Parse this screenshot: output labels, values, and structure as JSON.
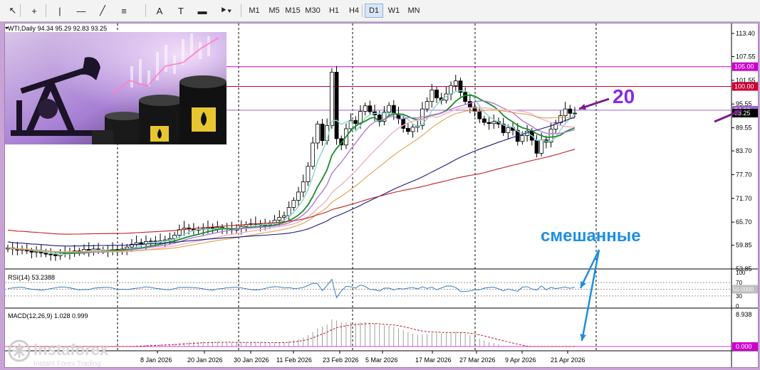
{
  "toolbar": {
    "tools": [
      {
        "name": "cursor",
        "glyph": "↖"
      },
      {
        "name": "crosshair",
        "glyph": "+"
      },
      {
        "name": "vertical-line",
        "glyph": "|"
      },
      {
        "name": "horizontal-line",
        "glyph": "—"
      },
      {
        "name": "trend-line",
        "glyph": "╱"
      },
      {
        "name": "fibonacci",
        "glyph": "≡"
      },
      {
        "name": "text-label",
        "glyph": "A"
      },
      {
        "name": "text-box",
        "glyph": "T"
      },
      {
        "name": "rectangle",
        "glyph": "▬"
      },
      {
        "name": "shapes-dropdown",
        "glyph": "⯈▾"
      }
    ],
    "timeframes": [
      "M1",
      "M5",
      "M15",
      "M30",
      "H1",
      "H4",
      "D1",
      "W1",
      "MN"
    ],
    "active_timeframe": "D1"
  },
  "chart_data": {
    "type": "candlestick",
    "header": "WTI,Daily  94.34 95.29 92.83 93.25",
    "symbol": "WTI",
    "timeframe": "Daily",
    "last_ohlc": {
      "open": 94.34,
      "high": 95.29,
      "low": 92.83,
      "close": 93.25
    },
    "y_ticks": [
      113.4,
      107.55,
      101.55,
      95.55,
      89.55,
      83.7,
      77.7,
      71.7,
      65.7,
      59.85,
      53.85
    ],
    "ylim": [
      53.85,
      113.4
    ],
    "x_labels": [
      "8 Jan 2026",
      "20 Jan 2026",
      "30 Jan 2026",
      "11 Feb 2026",
      "23 Feb 2026",
      "5 Mar 2026",
      "17 Mar 2026",
      "27 Mar 2026",
      "9 Apr 2026",
      "21 Apr 2026"
    ],
    "price_labels": [
      {
        "value": 105.0,
        "text": "105.00",
        "color": "#cc00cc"
      },
      {
        "value": 100.0,
        "text": "100.00",
        "color": "#cc0033"
      },
      {
        "value": 94.0,
        "text": "94.00",
        "color": "#9966cc"
      },
      {
        "value": 93.25,
        "text": "93.25",
        "color": "#000000"
      }
    ],
    "candles_close": [
      59.2,
      58.9,
      58.6,
      58.8,
      58.4,
      58.1,
      58.3,
      57.9,
      57.6,
      57.5,
      57.2,
      57.6,
      57.8,
      58.2,
      58.4,
      58.2,
      58.8,
      58.5,
      58.9,
      58.7,
      58.4,
      58.6,
      58.8,
      58.2,
      58.9,
      59.4,
      60.1,
      60.5,
      60.2,
      60.8,
      60.9,
      60.7,
      61.0,
      61.2,
      61.5,
      62.4,
      63.8,
      64.2,
      63.9,
      63.6,
      63.8,
      64.1,
      64.3,
      63.9,
      64.4,
      64.2,
      64.0,
      63.7,
      64.1,
      64.6,
      65.1,
      65.3,
      65.2,
      64.9,
      65.0,
      65.4,
      66.2,
      66.9,
      67.3,
      69.4,
      71.2,
      73.3,
      75.9,
      79.8,
      85.7,
      90.5,
      86.3,
      90.1,
      103.6,
      86.8,
      85.2,
      89.3,
      91.4,
      90.6,
      93.7,
      95.1,
      93.6,
      92.8,
      91.2,
      93.5,
      95.2,
      93.1,
      91.8,
      89.4,
      88.6,
      89.7,
      90.1,
      94.3,
      96.2,
      99.1,
      97.1,
      96.5,
      98.1,
      100.2,
      101.4,
      98.5,
      96.2,
      94.8,
      93.7,
      91.8,
      90.9,
      90.6,
      91.1,
      90.5,
      88.3,
      89.6,
      88.9,
      86.1,
      87.6,
      88.7,
      86.4,
      83.1,
      86.5,
      85.9,
      89.2,
      90.8,
      92.6,
      94.3,
      93.2,
      93.25
    ],
    "rsi": {
      "period": 14,
      "value": 53.2388,
      "levels": [
        70,
        50,
        30
      ],
      "axis_ticks": [
        100,
        70,
        30,
        0
      ],
      "level_label": "50.0000",
      "ylim": [
        0,
        100
      ]
    },
    "macd": {
      "fast": 12,
      "slow": 26,
      "signal": 9,
      "value": 1.028,
      "signal_value": 0.999,
      "axis_label": "8.938",
      "zero_label": "0.000"
    },
    "annotations": [
      {
        "text": "20",
        "color": "#8a2be2"
      },
      {
        "text": "смешанные",
        "color": "#1e8fe0"
      }
    ],
    "watermark": {
      "brand": "instaforex",
      "tagline": "Instant Forex Trading"
    }
  }
}
